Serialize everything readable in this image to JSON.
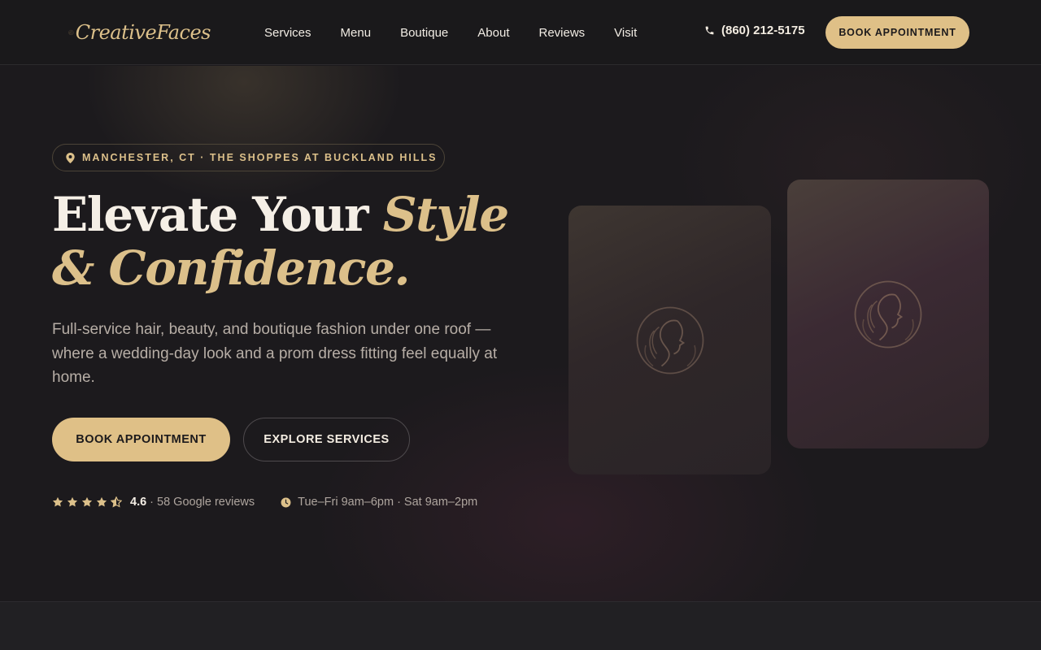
{
  "brand": {
    "name": "CreativeFaces",
    "logo_icon": "woman-silhouette-logo-icon",
    "accent": "#dfc087"
  },
  "nav": {
    "links": [
      "Services",
      "Menu",
      "Boutique",
      "About",
      "Reviews",
      "Visit"
    ],
    "phone": "(860) 212-5175",
    "phone_icon": "phone-icon",
    "book_label": "BOOK APPOINTMENT"
  },
  "hero": {
    "location": "MANCHESTER, CT · THE SHOPPES AT BUCKLAND HILLS",
    "location_icon": "map-pin-icon",
    "headline_plain": "Elevate Your ",
    "headline_accent": "Style & Confidence.",
    "subtext": "Full-service hair, beauty, and boutique fashion under one roof — where a wedding-day look and a prom dress fitting feel equally at home.",
    "primary_cta": "BOOK APPOINTMENT",
    "secondary_cta": "EXPLORE SERVICES",
    "rating": "4.6",
    "rating_stars": 4.5,
    "reviews": "· 58 Google reviews",
    "hours": "Tue–Fri 9am–6pm · Sat 9am–2pm",
    "hours_icon": "clock-icon"
  }
}
